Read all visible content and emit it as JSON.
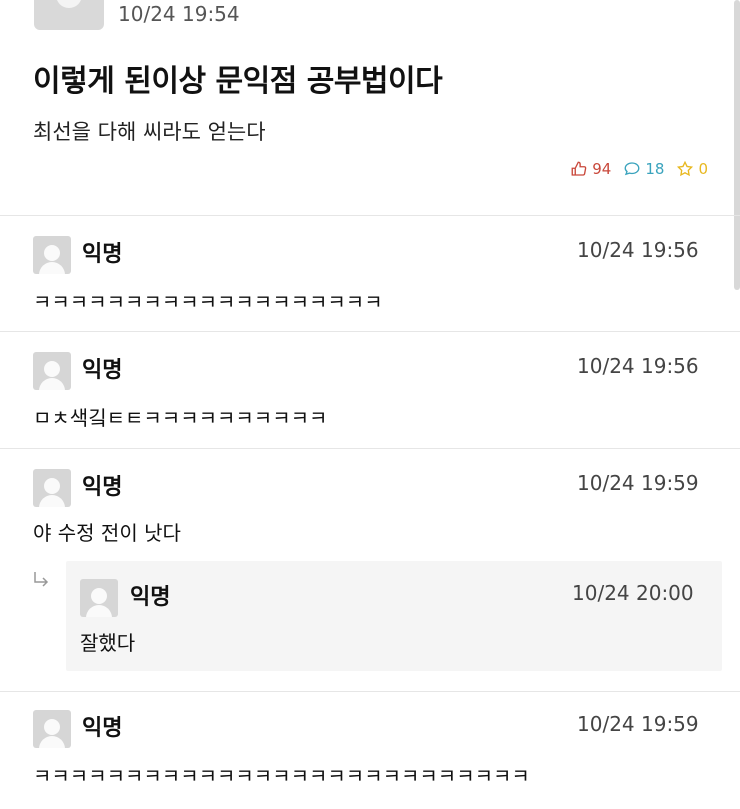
{
  "post": {
    "time": "10/24 19:54",
    "title": "이렇게 된이상 문익점 공부법이다",
    "body": "최선을 다해 씨라도 얻는다",
    "likes": "94",
    "comments": "18",
    "scraps": "0"
  },
  "comments": [
    {
      "author": "익명",
      "time": "10/24 19:56",
      "text": "ㅋㅋㅋㅋㅋㅋㅋㅋㅋㅋㅋㅋㅋㅋㅋㅋㅋㅋㅋ"
    },
    {
      "author": "익명",
      "time": "10/24 19:56",
      "text": "ㅁㅊ색깈ㅌㅌㅋㅋㅋㅋㅋㅋㅋㅋㅋㅋ"
    },
    {
      "author": "익명",
      "time": "10/24 19:59",
      "text": "야 수정 전이 낫다"
    },
    {
      "author": "익명",
      "time": "10/24 19:59",
      "text": "ㅋㅋㅋㅋㅋㅋㅋㅋㅋㅋㅋㅋㅋㅋㅋㅋㅋㅋㅋㅋㅋㅋㅋㅋㅋㅋㅋ"
    }
  ],
  "reply": {
    "author": "익명",
    "time": "10/24 20:00",
    "text": "잘했다"
  }
}
